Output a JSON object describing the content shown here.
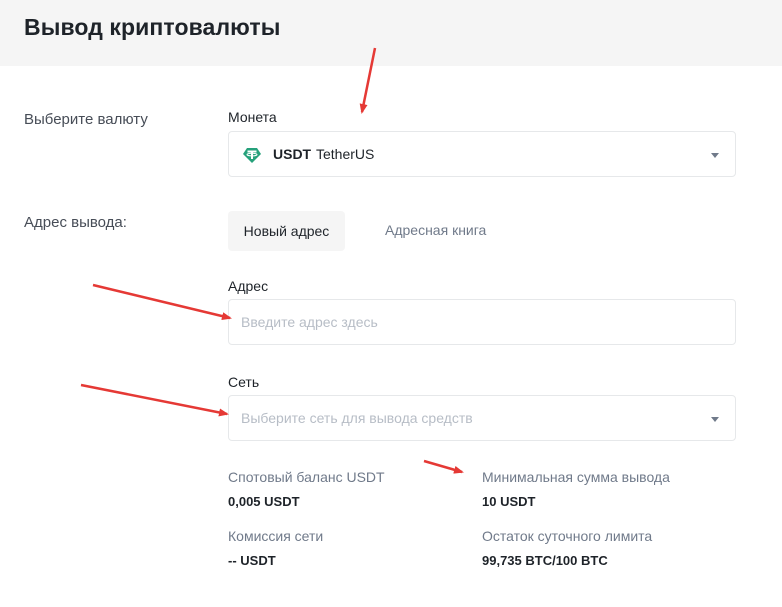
{
  "page": {
    "title": "Вывод криптовалюты"
  },
  "currency": {
    "row_label": "Выберите валюту",
    "coin_label": "Монета",
    "coin_symbol": "USDT",
    "coin_name": "TetherUS",
    "coin_icon": "tether-icon",
    "coin_color": "#26a17b"
  },
  "address": {
    "row_label": "Адрес вывода:",
    "tabs": [
      {
        "label": "Новый адрес",
        "active": true
      },
      {
        "label": "Адресная книга",
        "active": false
      }
    ],
    "field_label": "Адрес",
    "placeholder": "Введите адрес здесь"
  },
  "network": {
    "field_label": "Сеть",
    "placeholder": "Выберите сеть для вывода средств"
  },
  "info": {
    "spot_balance": {
      "label": "Спотовый баланс USDT",
      "value": "0,005 USDT"
    },
    "min_withdrawal": {
      "label": "Минимальная сумма вывода",
      "value": "10 USDT"
    },
    "network_fee": {
      "label": "Комиссия сети",
      "value": "-- USDT"
    },
    "daily_limit": {
      "label": "Остаток суточного лимита",
      "value": "99,735 BTC/100 BTC"
    }
  },
  "annotation_color": "#e53935"
}
